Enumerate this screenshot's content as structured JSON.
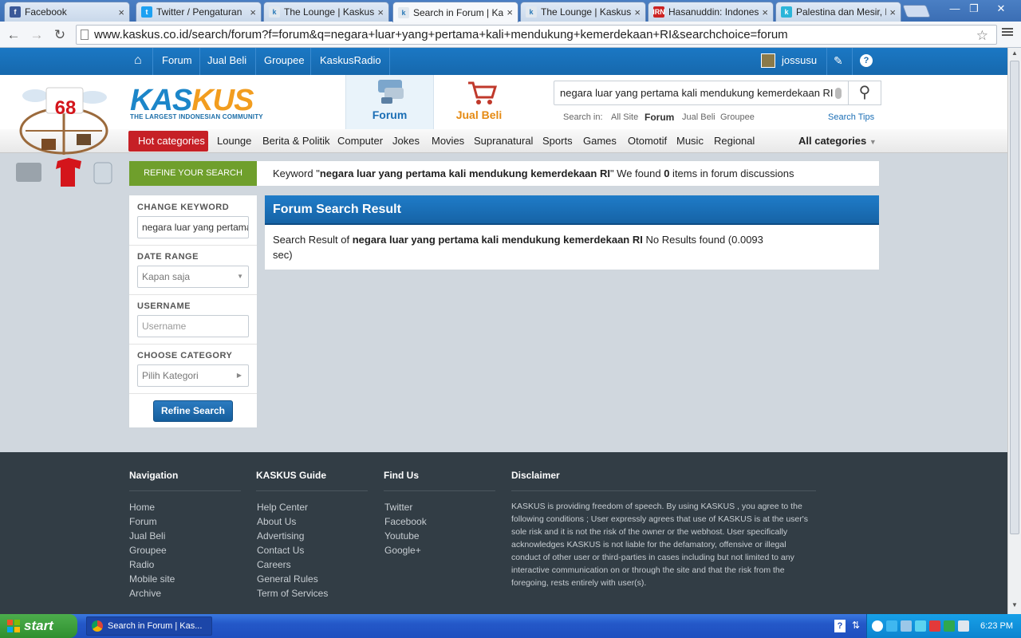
{
  "browser": {
    "tabs": [
      {
        "title": "Facebook",
        "fav": "f",
        "favcolor": "#3b5998"
      },
      {
        "title": "Twitter / Pengaturan",
        "fav": "t",
        "favcolor": "#1da1f2"
      },
      {
        "title": "The Lounge | Kaskus -",
        "fav": "k",
        "favcolor": "#e1e8ef"
      },
      {
        "title": "Search in Forum | Kas",
        "fav": "k",
        "favcolor": "#e1e8ef"
      },
      {
        "title": "The Lounge | Kaskus -",
        "fav": "k",
        "favcolor": "#e1e8ef"
      },
      {
        "title": "Hasanuddin: Indonesi",
        "fav": "IRN",
        "favcolor": "#c22"
      },
      {
        "title": "Palestina dan Mesir, N",
        "fav": "k",
        "favcolor": "#2bb5d9"
      }
    ],
    "url": "www.kaskus.co.id/search/forum?f=forum&q=negara+luar+yang+pertama+kali+mendukung+kemerdekaan+RI&searchchoice=forum"
  },
  "topnav": {
    "items": [
      "Forum",
      "Jual Beli",
      "Groupee",
      "KaskusRadio"
    ],
    "username": "jossusu"
  },
  "header": {
    "logo_word": "KASKUS",
    "logo_sub": "THE LARGEST INDONESIAN COMMUNITY",
    "badge_number": "68",
    "forum_tab": "Forum",
    "jualbeli_tab": "Jual Beli",
    "search_value": "negara luar yang pertama kali mendukung kemerdekaan RI",
    "search_in_label": "Search in:",
    "search_in_options": [
      "All Site",
      "Forum",
      "Jual Beli",
      "Groupee"
    ],
    "search_tips": "Search Tips"
  },
  "categories": {
    "hot": "Hot categories",
    "items": [
      "Lounge",
      "Berita & Politik",
      "Computer",
      "Jokes",
      "Movies",
      "Supranatural",
      "Sports",
      "Games",
      "Otomotif",
      "Music",
      "Regional"
    ],
    "all": "All categories"
  },
  "banner": {
    "tag": "REFINE YOUR SEARCH",
    "prefix": "Keyword \"",
    "keyword": "negara luar yang pertama kali mendukung kemerdekaan RI",
    "middle": "\" We found ",
    "count": "0",
    "suffix": " items in forum discussions"
  },
  "sidebar": {
    "change_keyword_label": "CHANGE KEYWORD",
    "keyword_value": "negara luar yang pertama kali mendukung kemerdekaan RI",
    "date_range_label": "DATE RANGE",
    "date_range_value": "Kapan saja",
    "username_label": "USERNAME",
    "username_placeholder": "Username",
    "category_label": "CHOOSE CATEGORY",
    "category_value": "Pilih Kategori",
    "refine_button": "Refine Search"
  },
  "result": {
    "title": "Forum Search Result",
    "prefix": "Search Result of ",
    "keyword": "negara luar yang pertama kali mendukung kemerdekaan RI",
    "suffix": " No Results found (0.0093 sec)"
  },
  "footer": {
    "navigation_title": "Navigation",
    "navigation": [
      "Home",
      "Forum",
      "Jual Beli",
      "Groupee",
      "Radio",
      "Mobile site",
      "Archive"
    ],
    "guide_title": "KASKUS Guide",
    "guide": [
      "Help Center",
      "About Us",
      "Advertising",
      "Contact Us",
      "Careers",
      "General Rules",
      "Term of Services"
    ],
    "findus_title": "Find Us",
    "findus": [
      "Twitter",
      "Facebook",
      "Youtube",
      "Google+"
    ],
    "disclaimer_title": "Disclaimer",
    "disclaimer": "KASKUS is providing freedom of speech. By using KASKUS , you agree to the following conditions ; User expressly agrees that use of KASKUS is at the user's sole risk and it is not the risk of the owner or the webhost. User specifically acknowledges KASKUS is not liable for the defamatory, offensive or illegal conduct of other user or third-parties in cases including but not limited to any interactive communication on or through the site and that the risk from the foregoing, rests entirely with user(s)."
  },
  "taskbar": {
    "start": "start",
    "item": "Search in Forum | Kas...",
    "clock": "6:23 PM"
  },
  "colors": {
    "kaskus_blue": "#1b78c4",
    "hot_red": "#c62026",
    "refine_green": "#6f9f2c",
    "footer_bg": "#323d45"
  }
}
